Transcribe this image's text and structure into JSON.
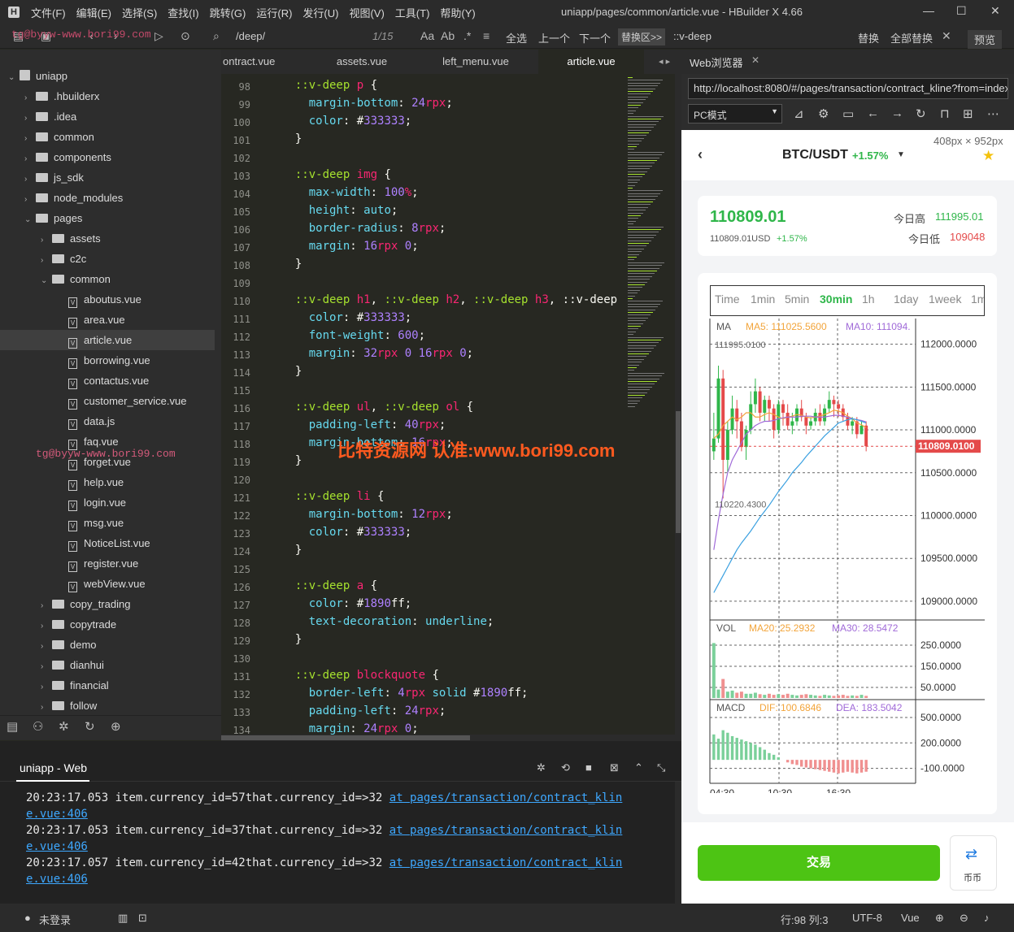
{
  "app": {
    "title": "uniapp/pages/common/article.vue - HBuilder X 4.66",
    "menus": [
      "文件(F)",
      "编辑(E)",
      "选择(S)",
      "查找(I)",
      "跳转(G)",
      "运行(R)",
      "发行(U)",
      "视图(V)",
      "工具(T)",
      "帮助(Y)"
    ]
  },
  "toolbar": {
    "search": "/deep/",
    "match": "1/15",
    "select_all": "全选",
    "prev": "上一个",
    "next": "下一个",
    "replace_area": "替换区>>",
    "replace_value": "::v-deep",
    "replace": "替换",
    "replace_all": "全部替换",
    "preview": "预览"
  },
  "sidebar": {
    "items": [
      {
        "label": "uniapp",
        "type": "root"
      },
      {
        "label": ".hbuilderx",
        "type": "folder"
      },
      {
        "label": ".idea",
        "type": "folder"
      },
      {
        "label": "common",
        "type": "folder"
      },
      {
        "label": "components",
        "type": "folder"
      },
      {
        "label": "js_sdk",
        "type": "folder"
      },
      {
        "label": "node_modules",
        "type": "folder"
      },
      {
        "label": "pages",
        "type": "folder"
      },
      {
        "label": "assets",
        "type": "folder"
      },
      {
        "label": "c2c",
        "type": "folder"
      },
      {
        "label": "common",
        "type": "folder"
      },
      {
        "label": "aboutus.vue",
        "type": "file"
      },
      {
        "label": "area.vue",
        "type": "file"
      },
      {
        "label": "article.vue",
        "type": "file"
      },
      {
        "label": "borrowing.vue",
        "type": "file"
      },
      {
        "label": "contactus.vue",
        "type": "file"
      },
      {
        "label": "customer_service.vue",
        "type": "file"
      },
      {
        "label": "data.js",
        "type": "file"
      },
      {
        "label": "faq.vue",
        "type": "file"
      },
      {
        "label": "forget.vue",
        "type": "file"
      },
      {
        "label": "help.vue",
        "type": "file"
      },
      {
        "label": "login.vue",
        "type": "file"
      },
      {
        "label": "msg.vue",
        "type": "file"
      },
      {
        "label": "NoticeList.vue",
        "type": "file"
      },
      {
        "label": "register.vue",
        "type": "file"
      },
      {
        "label": "webView.vue",
        "type": "file"
      },
      {
        "label": "copy_trading",
        "type": "folder"
      },
      {
        "label": "copytrade",
        "type": "folder"
      },
      {
        "label": "demo",
        "type": "folder"
      },
      {
        "label": "dianhui",
        "type": "folder"
      },
      {
        "label": "financial",
        "type": "folder"
      },
      {
        "label": "follow",
        "type": "folder"
      }
    ]
  },
  "tabs": [
    "ontract.vue",
    "assets.vue",
    "left_menu.vue",
    "article.vue"
  ],
  "editor": {
    "lines": [
      {
        "n": "98",
        "c": "  ::v-deep p {"
      },
      {
        "n": "99",
        "c": "    margin-bottom: 24rpx;"
      },
      {
        "n": "100",
        "c": "    color: #333333;"
      },
      {
        "n": "101",
        "c": "  }"
      },
      {
        "n": "102",
        "c": ""
      },
      {
        "n": "103",
        "c": "  ::v-deep img {"
      },
      {
        "n": "104",
        "c": "    max-width: 100%;"
      },
      {
        "n": "105",
        "c": "    height: auto;"
      },
      {
        "n": "106",
        "c": "    border-radius: 8rpx;"
      },
      {
        "n": "107",
        "c": "    margin: 16rpx 0;"
      },
      {
        "n": "108",
        "c": "  }"
      },
      {
        "n": "109",
        "c": ""
      },
      {
        "n": "110",
        "c": "  ::v-deep h1, ::v-deep h2, ::v-deep h3, ::v-deep"
      },
      {
        "n": "111",
        "c": "    color: #333333;"
      },
      {
        "n": "112",
        "c": "    font-weight: 600;"
      },
      {
        "n": "113",
        "c": "    margin: 32rpx 0 16rpx 0;"
      },
      {
        "n": "114",
        "c": "  }"
      },
      {
        "n": "115",
        "c": ""
      },
      {
        "n": "116",
        "c": "  ::v-deep ul, ::v-deep ol {"
      },
      {
        "n": "117",
        "c": "    padding-left: 40rpx;"
      },
      {
        "n": "118",
        "c": "    margin-bottom: 16rpx;"
      },
      {
        "n": "119",
        "c": "  }"
      },
      {
        "n": "120",
        "c": ""
      },
      {
        "n": "121",
        "c": "  ::v-deep li {"
      },
      {
        "n": "122",
        "c": "    margin-bottom: 12rpx;"
      },
      {
        "n": "123",
        "c": "    color: #333333;"
      },
      {
        "n": "124",
        "c": "  }"
      },
      {
        "n": "125",
        "c": ""
      },
      {
        "n": "126",
        "c": "  ::v-deep a {"
      },
      {
        "n": "127",
        "c": "    color: #1890ff;"
      },
      {
        "n": "128",
        "c": "    text-decoration: underline;"
      },
      {
        "n": "129",
        "c": "  }"
      },
      {
        "n": "130",
        "c": ""
      },
      {
        "n": "131",
        "c": "  ::v-deep blockquote {"
      },
      {
        "n": "132",
        "c": "    border-left: 4rpx solid #1890ff;"
      },
      {
        "n": "133",
        "c": "    padding-left: 24rpx;"
      },
      {
        "n": "134",
        "c": "    margin: 24rpx 0;"
      }
    ]
  },
  "watermark": {
    "main": "比特资源网 认准:www.bori99.com",
    "email": "tg@byyw-www.bori99.com"
  },
  "console": {
    "title": "uniapp - Web",
    "logs": [
      {
        "time": "20:23:17.053",
        "msg": "item.currency_id=57that.currency_id=>32",
        "link1": "at pages/transaction/contract_klin",
        "link2": "e.vue:406"
      },
      {
        "time": "20:23:17.053",
        "msg": "item.currency_id=37that.currency_id=>32",
        "link1": "at pages/transaction/contract_klin",
        "link2": "e.vue:406"
      },
      {
        "time": "20:23:17.057",
        "msg": "item.currency_id=42that.currency_id=>32",
        "link1": "at pages/transaction/contract_klin",
        "link2": "e.vue:406"
      }
    ]
  },
  "status": {
    "login": "未登录",
    "position": "行:98  列:3",
    "encoding": "UTF-8",
    "lang": "Vue"
  },
  "browser": {
    "tab": "Web浏览器",
    "url": "http://localhost:8080/#/pages/transaction/contract_kline?from=index",
    "mode": "PC模式",
    "size": "408px × 952px"
  },
  "phone": {
    "pair": "BTC/USDT",
    "change": "+1.57%",
    "price": "110809.01",
    "price_usd": "110809.01USD",
    "price_change": "+1.57%",
    "high_label": "今日高",
    "high": "111995.01",
    "low_label": "今日低",
    "low": "109048",
    "timeframes": [
      "Time",
      "1min",
      "5min",
      "30min",
      "1h",
      "1day",
      "1week",
      "1mon"
    ],
    "active_tf": "30min",
    "ma_label": "MA",
    "ma5": "MA5: 111025.5600",
    "ma10": "MA10: 111094.",
    "vol_label": "VOL",
    "ma20": "MA20: 25.2932",
    "ma30": "MA30: 28.5472",
    "macd_label": "MACD",
    "dif": "DIF: 100.6846",
    "dea": "DEA: 183.5042",
    "trade": "交易",
    "coin": "币币"
  },
  "chart_data": {
    "type": "candlestick",
    "y_ticks": [
      "112000.0000",
      "111500.0000",
      "111000.0000",
      "110500.0000",
      "110000.0000",
      "109500.0000",
      "109000.0000"
    ],
    "vol_ticks": [
      "250.0000",
      "150.0000",
      "50.0000"
    ],
    "macd_ticks": [
      "500.0000",
      "200.0000",
      "-100.0000"
    ],
    "x_ticks": [
      "04:30",
      "10:30",
      "16:30"
    ],
    "high_mark": "111995.0100",
    "low_mark": "110220.4300",
    "last": "110809.0100",
    "ylim": [
      108800,
      112300
    ],
    "candles": [
      [
        110750,
        110900,
        111200,
        110650
      ],
      [
        110900,
        111600,
        111750,
        110850
      ],
      [
        111600,
        110650,
        111700,
        110200
      ],
      [
        110650,
        111000,
        111100,
        110500
      ],
      [
        111000,
        111250,
        111400,
        110950
      ],
      [
        111250,
        111100,
        111350,
        110900
      ],
      [
        111100,
        110800,
        111200,
        110750
      ],
      [
        110800,
        111000,
        111050,
        110650
      ],
      [
        111000,
        111300,
        111450,
        110950
      ],
      [
        111300,
        111450,
        111600,
        111200
      ],
      [
        111450,
        111200,
        111500,
        111100
      ],
      [
        111200,
        111350,
        111400,
        111100
      ],
      [
        111350,
        111250,
        111400,
        111100
      ],
      [
        111250,
        111000,
        111300,
        110900
      ],
      [
        111000,
        111300,
        111350,
        110950
      ],
      [
        111300,
        111200,
        111350,
        111050
      ],
      [
        111200,
        111050,
        111300,
        111000
      ],
      [
        111050,
        111100,
        111200,
        110950
      ],
      [
        111100,
        111250,
        111300,
        111050
      ],
      [
        111250,
        111150,
        111350,
        111100
      ],
      [
        111150,
        111050,
        111200,
        110950
      ],
      [
        111050,
        111100,
        111150,
        111000
      ],
      [
        111100,
        111200,
        111250,
        111050
      ],
      [
        111200,
        111100,
        111300,
        111050
      ],
      [
        111100,
        111250,
        111300,
        111050
      ],
      [
        111250,
        111350,
        111450,
        111200
      ],
      [
        111350,
        111300,
        111400,
        111150
      ],
      [
        111300,
        111250,
        111350,
        111150
      ],
      [
        111250,
        111150,
        111300,
        111100
      ],
      [
        111150,
        111050,
        111200,
        111000
      ],
      [
        111050,
        111100,
        111150,
        110950
      ],
      [
        111100,
        110950,
        111150,
        110900
      ],
      [
        110950,
        111050,
        111100,
        110950
      ],
      [
        111050,
        110809,
        111100,
        110750
      ]
    ],
    "ma5": [
      110900,
      110950,
      111050,
      111100,
      111150,
      111120,
      111150,
      111200,
      111200,
      111150,
      111150,
      111180,
      111200,
      111180,
      111150,
      111130,
      111150,
      111160,
      111180,
      111170,
      111150,
      111140,
      111150,
      111160,
      111180,
      111200,
      111230,
      111220,
      111200,
      111160,
      111130,
      111080,
      111060,
      111025
    ],
    "ma10": [
      109600,
      109950,
      110250,
      110500,
      110650,
      110750,
      110850,
      110950,
      111000,
      111050,
      111080,
      111100,
      111100,
      111110,
      111130,
      111140,
      111150,
      111150,
      111150,
      111160,
      111160,
      111160,
      111150,
      111150,
      111150,
      111160,
      111170,
      111170,
      111160,
      111150,
      111130,
      111120,
      111110,
      111094
    ],
    "ma_long": [
      109100,
      109200,
      109300,
      109400,
      109500,
      109600,
      109680,
      109750,
      109820,
      109900,
      109980,
      110050,
      110120,
      110200,
      110280,
      110350,
      110420,
      110500,
      110560,
      110620,
      110690,
      110750,
      110810,
      110870,
      110930,
      110980,
      111030,
      111080,
      111100,
      111120,
      111130,
      111120,
      111100,
      111080
    ],
    "volumes": [
      260,
      40,
      90,
      30,
      35,
      25,
      30,
      20,
      20,
      25,
      18,
      15,
      20,
      15,
      18,
      15,
      20,
      15,
      12,
      15,
      18,
      15,
      12,
      10,
      15,
      12,
      10,
      12,
      15,
      10,
      12,
      10,
      15,
      10
    ],
    "macd": [
      300,
      250,
      350,
      320,
      280,
      260,
      240,
      220,
      200,
      180,
      150,
      120,
      80,
      60,
      30,
      0,
      -30,
      -50,
      -60,
      -80,
      -90,
      -100,
      -110,
      -120,
      -130,
      -140,
      -150,
      -160,
      -150,
      -140,
      -150,
      -160,
      -150,
      -140
    ]
  }
}
